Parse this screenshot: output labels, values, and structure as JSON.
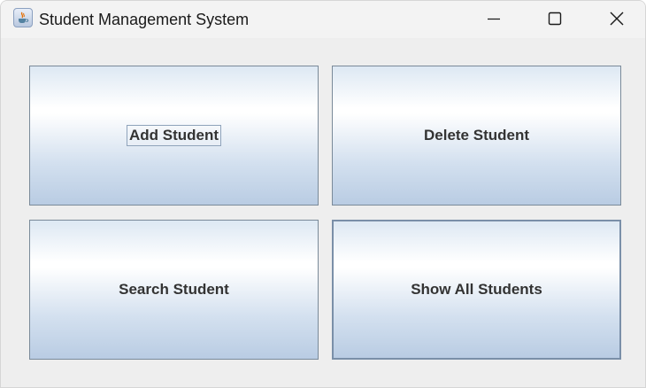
{
  "window": {
    "title": "Student Management System",
    "app_icon": "java-cup-icon"
  },
  "window_controls": {
    "minimize_icon": "minimize-icon",
    "maximize_icon": "maximize-icon",
    "close_icon": "close-icon"
  },
  "buttons": {
    "add": "Add Student",
    "delete": "Delete Student",
    "search": "Search Student",
    "show_all": "Show All Students"
  },
  "colors": {
    "button_border": "#7a8a99",
    "button_gradient_top": "#ffffff",
    "button_gradient_bottom": "#b9cce3",
    "panel_background": "#eeeeee",
    "label_text": "#333333"
  }
}
